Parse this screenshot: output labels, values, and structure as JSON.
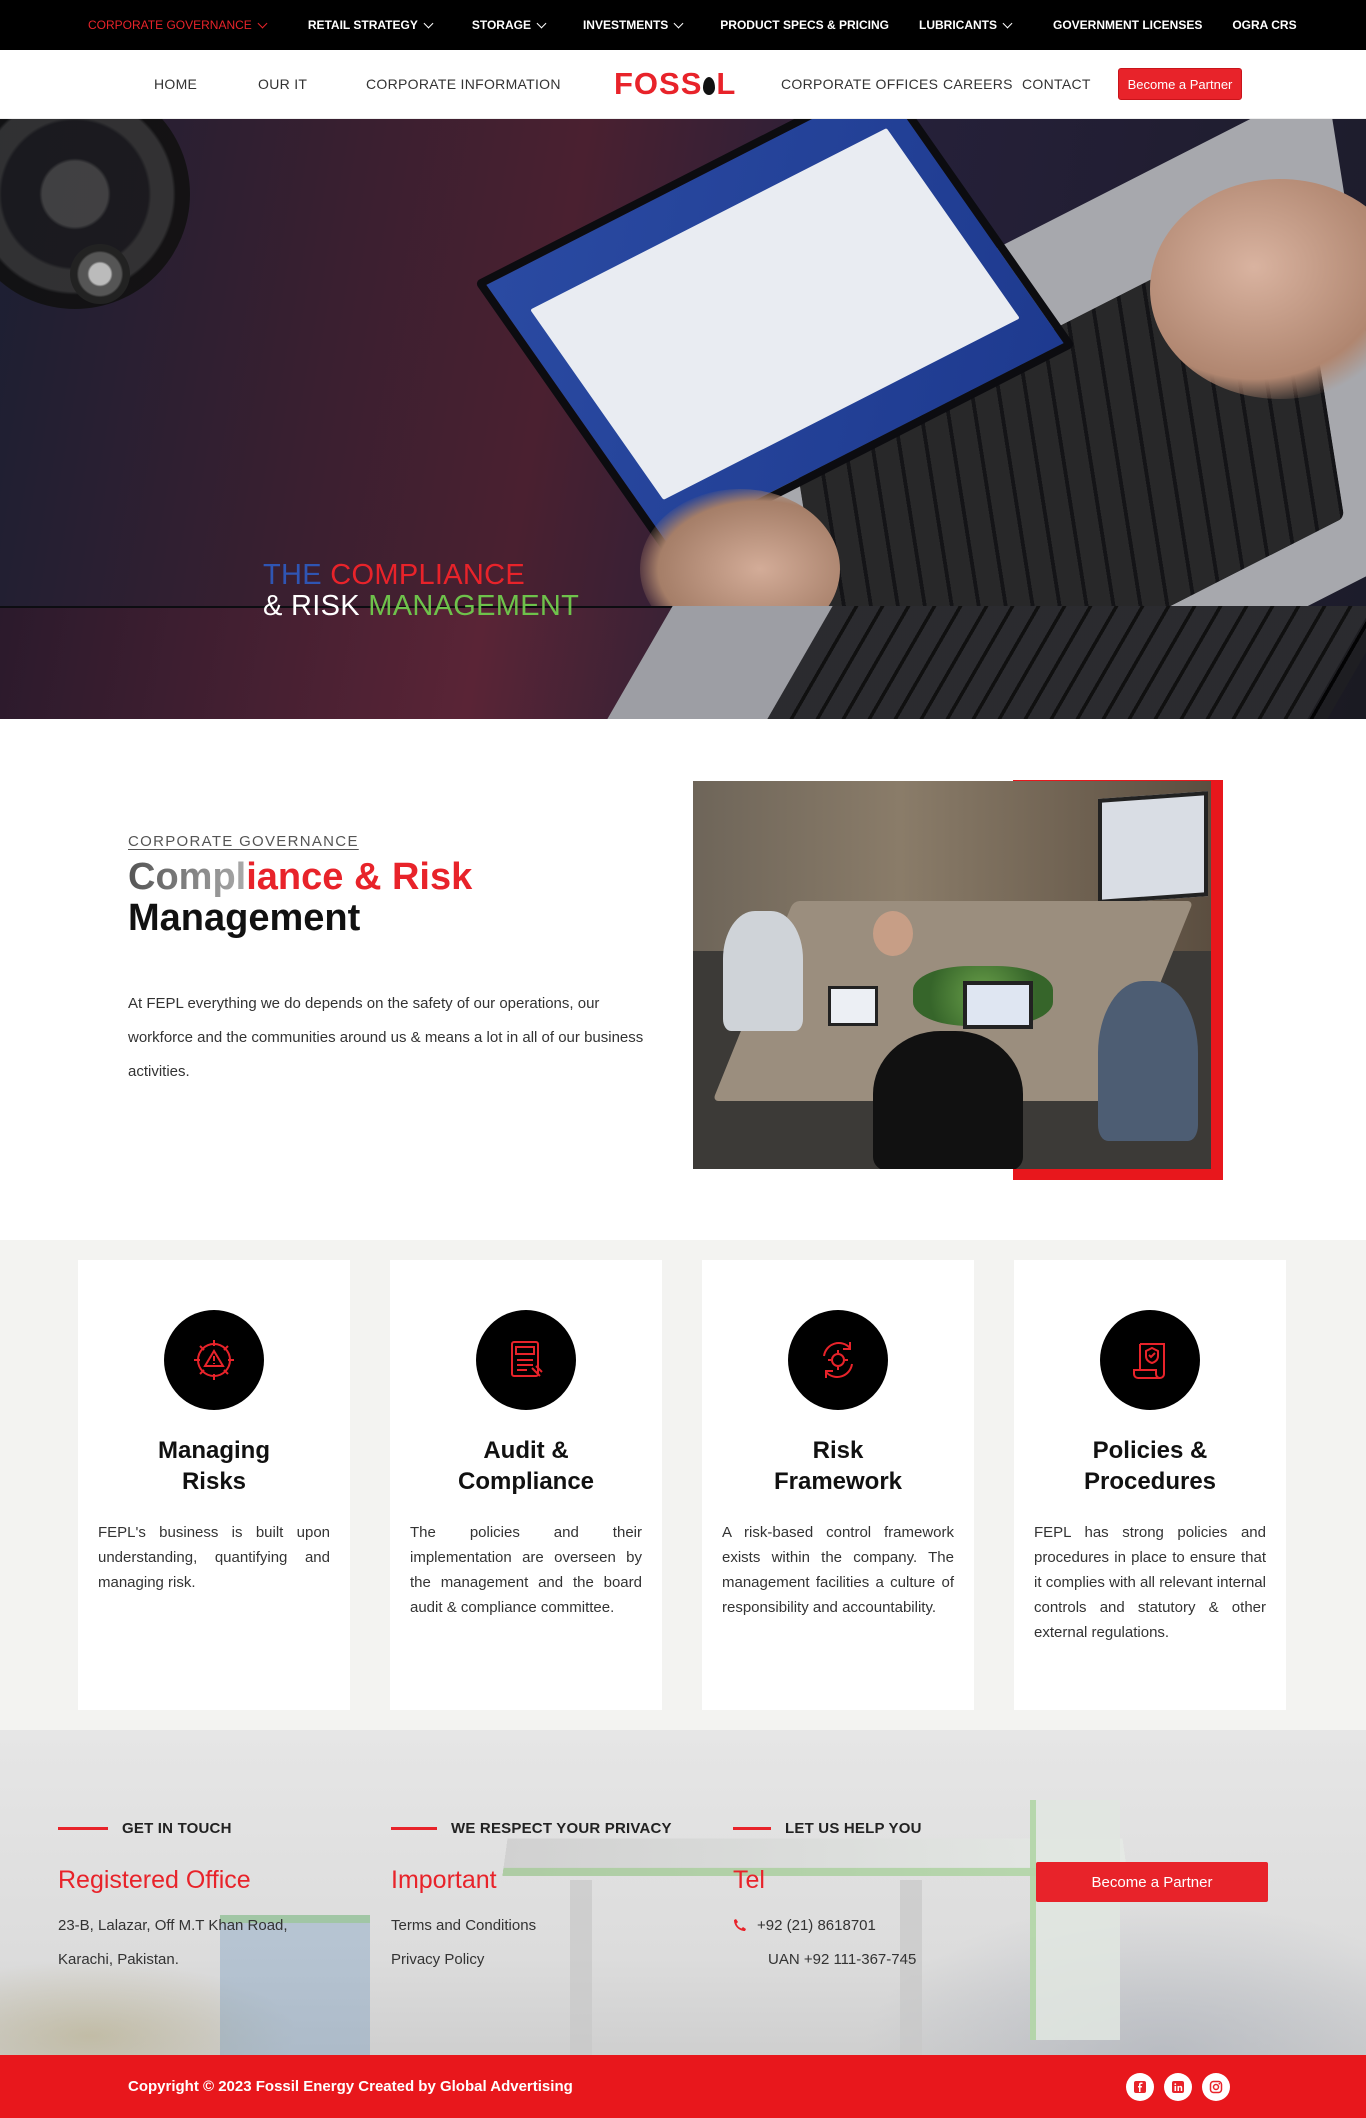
{
  "topbar": {
    "items": [
      {
        "label": "CORPORATE GOVERNANCE",
        "dropdown": true,
        "active": true
      },
      {
        "label": "RETAIL STRATEGY",
        "dropdown": true
      },
      {
        "label": "STORAGE",
        "dropdown": true
      },
      {
        "label": "INVESTMENTS",
        "dropdown": true
      },
      {
        "label": "PRODUCT SPECS & PRICING",
        "dropdown": false
      },
      {
        "label": "LUBRICANTS",
        "dropdown": true
      },
      {
        "label": "GOVERNMENT LICENSES",
        "dropdown": false
      },
      {
        "label": "OGRA CRS",
        "dropdown": false
      }
    ]
  },
  "nav": {
    "links": [
      "HOME",
      "OUR IT",
      "CORPORATE INFORMATION",
      "CORPORATE OFFICES",
      "CAREERS",
      "CONTACT"
    ],
    "logo": {
      "before": "FOSS",
      "after": "L"
    },
    "partner_label": "Become a Partner"
  },
  "hero": {
    "line1_a": "THE ",
    "line1_b": "COMPLIANCE",
    "line2_a": "& RISK ",
    "line2_b": "MANAGEMENT"
  },
  "intro": {
    "eyebrow": "CORPORATE GOVERNANCE",
    "title_gray": "Compl",
    "title_red": "iance & Risk",
    "title_line2": "Management",
    "text": "At FEPL everything we do depends on the safety of our operations, our workforce and the communities around us & means a lot in all of our business activities."
  },
  "cards": [
    {
      "icon": "warning-gear-icon",
      "title": "Managing\nRisks",
      "body": "FEPL's business is built upon understanding, quantifying and managing risk."
    },
    {
      "icon": "audit-icon",
      "title": "Audit &\nCompliance",
      "body": "The policies and their implementation are overseen by the management and the board audit & compliance committee."
    },
    {
      "icon": "risk-cycle-icon",
      "title": "Risk\nFramework",
      "body": "A risk-based control framework exists within the company. The management facilities a culture of responsibility and accountability."
    },
    {
      "icon": "policy-scroll-icon",
      "title": "Policies &\nProcedures",
      "body": "FEPL has strong policies and procedures in place to ensure that it complies with all relevant internal controls and statutory & other external regulations."
    }
  ],
  "footer": {
    "col1": {
      "head": "GET IN TOUCH",
      "sub": "Registered Office",
      "lines": [
        "23-B, Lalazar, Off M.T Khan Road,",
        "Karachi, Pakistan."
      ]
    },
    "col2": {
      "head": "WE RESPECT YOUR PRIVACY",
      "sub": "Important",
      "lines": [
        "Terms and Conditions",
        "Privacy Policy"
      ]
    },
    "col3": {
      "head": "LET US HELP YOU",
      "sub": "Tel",
      "lines": [
        "+92 (21) 8618701",
        "UAN +92 111-367-745"
      ]
    },
    "partner_label": "Become a Partner"
  },
  "bottom": {
    "copyright": "Copyright © 2023 Fossil Energy Created by Global Advertising",
    "social": [
      "facebook-icon",
      "linkedin-icon",
      "instagram-icon"
    ]
  },
  "colors": {
    "brand_red": "#e8232a",
    "blue": "#2f55b3",
    "green": "#6ec24b",
    "black": "#000000"
  }
}
